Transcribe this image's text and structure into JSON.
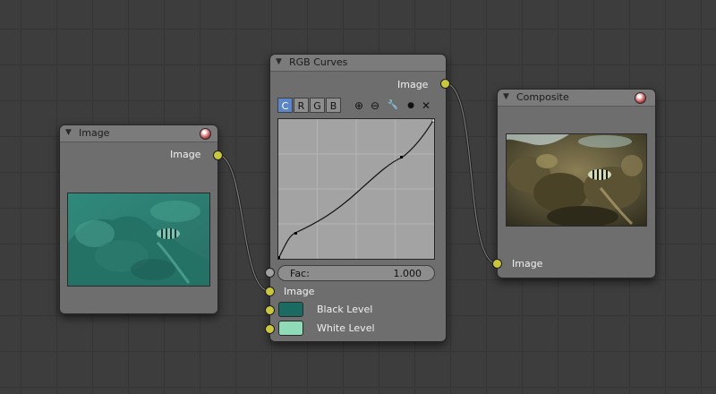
{
  "colors": {
    "socket_color": "#c8c83a",
    "socket_grey": "#a1a1a1",
    "node_bg": "#6e6e6e",
    "active_channel": "#5b86c9",
    "black_level": "#1b6b63",
    "white_level": "#8fdab7"
  },
  "image_node": {
    "title": "Image",
    "output_label": "Image",
    "thumbnail": "teal-underwater-reef-photo"
  },
  "curves_node": {
    "title": "RGB Curves",
    "output_label": "Image",
    "channels": [
      "C",
      "R",
      "G",
      "B"
    ],
    "active_channel": "C",
    "tools": [
      "zoom-in-icon",
      "zoom-out-icon",
      "wrench-icon",
      "dot-icon",
      "x-icon"
    ],
    "tool_glyphs": [
      "⊕",
      "⊖",
      "🔧",
      "●",
      "✕"
    ],
    "fac_label": "Fac:",
    "fac_value": "1.000",
    "input_image_label": "Image",
    "black_level_label": "Black Level",
    "white_level_label": "White Level"
  },
  "composite_node": {
    "title": "Composite",
    "input_label": "Image",
    "thumbnail": "color-corrected-reef-photo"
  }
}
